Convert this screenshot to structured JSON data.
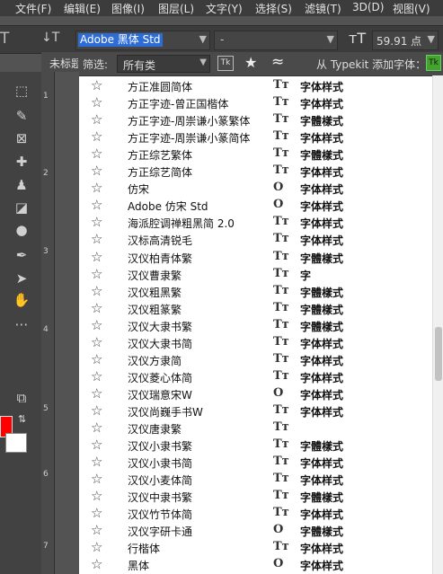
{
  "menu": [
    "文件(F)",
    "编辑(E)",
    "图像(I)",
    "图层(L)",
    "文字(Y)",
    "选择(S)",
    "滤镜(T)",
    "3D(D)",
    "视图(V)"
  ],
  "options": {
    "tool_glyph": "T",
    "orient_glyph": "↓T",
    "font_value": "Adobe 黑体 Std",
    "style_value": "-",
    "size_glyph": "тT",
    "size_value": "59.91 点"
  },
  "doc_tab": "未标题",
  "filter": {
    "label": "筛选:",
    "category": "所有类",
    "tk": "Tk",
    "typekit_label": "从 Typekit 添加字体：",
    "tk2": "Tk"
  },
  "ruler_marks": [
    "1",
    "2",
    "3",
    "4",
    "5",
    "6",
    "7"
  ],
  "fonts": [
    {
      "name": "方正准圆简体",
      "type": "Tт",
      "sample": "字体样式"
    },
    {
      "name": "方正字迹-曾正国楷体",
      "type": "Tт",
      "sample": "字体样式"
    },
    {
      "name": "方正字迹-周崇谦小篆繁体",
      "type": "Tт",
      "sample": "字體樣式"
    },
    {
      "name": "方正字迹-周崇谦小篆简体",
      "type": "Tт",
      "sample": "字体样式"
    },
    {
      "name": "方正综艺繁体",
      "type": "Tт",
      "sample": "字體樣式"
    },
    {
      "name": "方正综艺简体",
      "type": "Tт",
      "sample": "字体样式"
    },
    {
      "name": "仿宋",
      "type": "O",
      "sample": "字体样式"
    },
    {
      "name": "Adobe 仿宋 Std",
      "type": "O",
      "sample": "字体样式"
    },
    {
      "name": "海派腔调禅粗黑简 2.0",
      "type": "Tт",
      "sample": "字体样式"
    },
    {
      "name": "汉标高清锐毛",
      "type": "Tт",
      "sample": "字体样式"
    },
    {
      "name": "汉仪柏青体繁",
      "type": "Tт",
      "sample": "字體樣式"
    },
    {
      "name": "汉仪曹隶繁",
      "type": "Tт",
      "sample": "字"
    },
    {
      "name": "汉仪粗黑繁",
      "type": "Tт",
      "sample": "字體樣式"
    },
    {
      "name": "汉仪粗篆繁",
      "type": "Tт",
      "sample": "字體樣式"
    },
    {
      "name": "汉仪大隶书繁",
      "type": "Tт",
      "sample": "字體樣式"
    },
    {
      "name": "汉仪大隶书简",
      "type": "Tт",
      "sample": "字体样式"
    },
    {
      "name": "汉仪方隶简",
      "type": "Tт",
      "sample": "字体样式"
    },
    {
      "name": "汉仪菱心体简",
      "type": "Tт",
      "sample": "字体样式"
    },
    {
      "name": "汉仪瑞意宋W",
      "type": "O",
      "sample": "字体样式"
    },
    {
      "name": "汉仪尚巍手书W",
      "type": "Tт",
      "sample": "字体样式"
    },
    {
      "name": "汉仪唐隶繁",
      "type": "Tт",
      "sample": ""
    },
    {
      "name": "汉仪小隶书繁",
      "type": "Tт",
      "sample": "字體樣式"
    },
    {
      "name": "汉仪小隶书简",
      "type": "Tт",
      "sample": "字体样式"
    },
    {
      "name": "汉仪小麦体简",
      "type": "Tт",
      "sample": "字体样式"
    },
    {
      "name": "汉仪中隶书繁",
      "type": "Tт",
      "sample": "字體樣式"
    },
    {
      "name": "汉仪竹节体简",
      "type": "Tт",
      "sample": "字体样式"
    },
    {
      "name": "汉仪字研卡通",
      "type": "O",
      "sample": "字體樣式"
    },
    {
      "name": "行楷体",
      "type": "Tт",
      "sample": "字体样式"
    },
    {
      "name": "黑体",
      "type": "O",
      "sample": "字体样式"
    }
  ]
}
